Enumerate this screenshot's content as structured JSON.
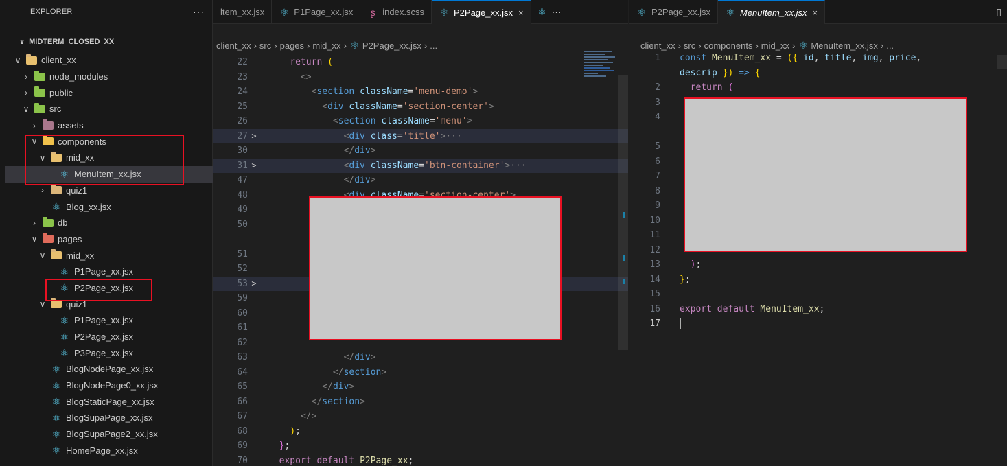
{
  "sidebar": {
    "title": "EXPLORER",
    "more": "···",
    "root": "MIDTERM_CLOSED_XX",
    "tree": [
      {
        "label": "client_xx",
        "depth": 1,
        "kind": "folder-open",
        "chev": "down"
      },
      {
        "label": "node_modules",
        "depth": 2,
        "kind": "folder-green",
        "chev": "right"
      },
      {
        "label": "public",
        "depth": 2,
        "kind": "folder-green",
        "chev": "right"
      },
      {
        "label": "src",
        "depth": 2,
        "kind": "folder-green",
        "chev": "down"
      },
      {
        "label": "assets",
        "depth": 3,
        "kind": "folder-pink",
        "chev": "right"
      },
      {
        "label": "components",
        "depth": 3,
        "kind": "folder-yellow",
        "chev": "down"
      },
      {
        "label": "mid_xx",
        "depth": 4,
        "kind": "folder-open",
        "chev": "down"
      },
      {
        "label": "MenuItem_xx.jsx",
        "depth": 5,
        "kind": "react",
        "chev": "none",
        "selected": true
      },
      {
        "label": "quiz1",
        "depth": 4,
        "kind": "folder",
        "chev": "right"
      },
      {
        "label": "Blog_xx.jsx",
        "depth": 4,
        "kind": "react",
        "chev": "none"
      },
      {
        "label": "db",
        "depth": 3,
        "kind": "folder-green",
        "chev": "right"
      },
      {
        "label": "pages",
        "depth": 3,
        "kind": "folder-red",
        "chev": "down"
      },
      {
        "label": "mid_xx",
        "depth": 4,
        "kind": "folder-open",
        "chev": "down"
      },
      {
        "label": "P1Page_xx.jsx",
        "depth": 5,
        "kind": "react",
        "chev": "none"
      },
      {
        "label": "P2Page_xx.jsx",
        "depth": 5,
        "kind": "react",
        "chev": "none"
      },
      {
        "label": "quiz1",
        "depth": 4,
        "kind": "folder-open",
        "chev": "down"
      },
      {
        "label": "P1Page_xx.jsx",
        "depth": 5,
        "kind": "react",
        "chev": "none"
      },
      {
        "label": "P2Page_xx.jsx",
        "depth": 5,
        "kind": "react",
        "chev": "none"
      },
      {
        "label": "P3Page_xx.jsx",
        "depth": 5,
        "kind": "react",
        "chev": "none"
      },
      {
        "label": "BlogNodePage_xx.jsx",
        "depth": 4,
        "kind": "react",
        "chev": "none"
      },
      {
        "label": "BlogNodePage0_xx.jsx",
        "depth": 4,
        "kind": "react",
        "chev": "none"
      },
      {
        "label": "BlogStaticPage_xx.jsx",
        "depth": 4,
        "kind": "react",
        "chev": "none"
      },
      {
        "label": "BlogSupaPage_xx.jsx",
        "depth": 4,
        "kind": "react",
        "chev": "none"
      },
      {
        "label": "BlogSupaPage2_xx.jsx",
        "depth": 4,
        "kind": "react",
        "chev": "none"
      },
      {
        "label": "HomePage_xx.jsx",
        "depth": 4,
        "kind": "react",
        "chev": "none"
      }
    ]
  },
  "editor1": {
    "tabs": [
      {
        "label": "ltem_xx.jsx",
        "icon": "none"
      },
      {
        "label": "P1Page_xx.jsx",
        "icon": "react"
      },
      {
        "label": "index.scss",
        "icon": "sass"
      },
      {
        "label": "P2Page_xx.jsx",
        "icon": "react",
        "active": true,
        "close": "×"
      }
    ],
    "tab_overflow": "···",
    "breadcrumb": [
      "client_xx",
      "src",
      "pages",
      "mid_xx",
      "P2Page_xx.jsx",
      "..."
    ],
    "lines": [
      {
        "n": "22",
        "code": [
          [
            "    ",
            "plain"
          ],
          [
            "return",
            "kw2"
          ],
          [
            " (",
            "br1"
          ]
        ]
      },
      {
        "n": "23",
        "code": [
          [
            "      ",
            "plain"
          ],
          [
            "<>",
            "pun"
          ]
        ]
      },
      {
        "n": "24",
        "code": [
          [
            "        ",
            "plain"
          ],
          [
            "<",
            "pun"
          ],
          [
            "section",
            "tag"
          ],
          [
            " ",
            "plain"
          ],
          [
            "className",
            "attr"
          ],
          [
            "=",
            "plain"
          ],
          [
            "'menu-demo'",
            "str"
          ],
          [
            ">",
            "pun"
          ]
        ]
      },
      {
        "n": "25",
        "code": [
          [
            "          ",
            "plain"
          ],
          [
            "<",
            "pun"
          ],
          [
            "div",
            "tag"
          ],
          [
            " ",
            "plain"
          ],
          [
            "className",
            "attr"
          ],
          [
            "=",
            "plain"
          ],
          [
            "'section-center'",
            "str"
          ],
          [
            ">",
            "pun"
          ]
        ]
      },
      {
        "n": "26",
        "code": [
          [
            "            ",
            "plain"
          ],
          [
            "<",
            "pun"
          ],
          [
            "section",
            "tag"
          ],
          [
            " ",
            "plain"
          ],
          [
            "className",
            "attr"
          ],
          [
            "=",
            "plain"
          ],
          [
            "'menu'",
            "str"
          ],
          [
            ">",
            "pun"
          ]
        ]
      },
      {
        "n": "27",
        "fold": ">",
        "folded": true,
        "code": [
          [
            "              ",
            "plain"
          ],
          [
            "<",
            "pun"
          ],
          [
            "div",
            "tag"
          ],
          [
            " ",
            "plain"
          ],
          [
            "class",
            "attr"
          ],
          [
            "=",
            "plain"
          ],
          [
            "'title'",
            "str"
          ],
          [
            ">",
            "pun"
          ],
          [
            "···",
            "ell"
          ]
        ]
      },
      {
        "n": "30",
        "code": [
          [
            "              ",
            "plain"
          ],
          [
            "</",
            "pun"
          ],
          [
            "div",
            "tag"
          ],
          [
            ">",
            "pun"
          ]
        ]
      },
      {
        "n": "31",
        "fold": ">",
        "folded": true,
        "code": [
          [
            "              ",
            "plain"
          ],
          [
            "<",
            "pun"
          ],
          [
            "div",
            "tag"
          ],
          [
            " ",
            "plain"
          ],
          [
            "className",
            "attr"
          ],
          [
            "=",
            "plain"
          ],
          [
            "'btn-container'",
            "str"
          ],
          [
            ">",
            "pun"
          ],
          [
            "···",
            "ell"
          ]
        ]
      },
      {
        "n": "47",
        "code": [
          [
            "              ",
            "plain"
          ],
          [
            "</",
            "pun"
          ],
          [
            "div",
            "tag"
          ],
          [
            ">",
            "pun"
          ]
        ]
      },
      {
        "n": "48",
        "code": [
          [
            "              ",
            "plain"
          ],
          [
            "<",
            "pun"
          ],
          [
            "div",
            "tag"
          ],
          [
            " ",
            "plain"
          ],
          [
            "className",
            "attr"
          ],
          [
            "=",
            "plain"
          ],
          [
            "'section-center'",
            "str"
          ],
          [
            ">",
            "pun"
          ]
        ]
      },
      {
        "n": "49",
        "code": []
      },
      {
        "n": "50",
        "code": []
      },
      {
        "n": "",
        "code": []
      },
      {
        "n": "51",
        "code": []
      },
      {
        "n": "52",
        "code": []
      },
      {
        "n": "53",
        "fold": ">",
        "folded": true,
        "code": []
      },
      {
        "n": "59",
        "code": []
      },
      {
        "n": "60",
        "code": []
      },
      {
        "n": "61",
        "code": []
      },
      {
        "n": "62",
        "code": []
      },
      {
        "n": "63",
        "code": [
          [
            "              ",
            "plain"
          ],
          [
            "</",
            "pun"
          ],
          [
            "div",
            "tag"
          ],
          [
            ">",
            "pun"
          ]
        ]
      },
      {
        "n": "64",
        "code": [
          [
            "            ",
            "plain"
          ],
          [
            "</",
            "pun"
          ],
          [
            "section",
            "tag"
          ],
          [
            ">",
            "pun"
          ]
        ]
      },
      {
        "n": "65",
        "code": [
          [
            "          ",
            "plain"
          ],
          [
            "</",
            "pun"
          ],
          [
            "div",
            "tag"
          ],
          [
            ">",
            "pun"
          ]
        ]
      },
      {
        "n": "66",
        "code": [
          [
            "        ",
            "plain"
          ],
          [
            "</",
            "pun"
          ],
          [
            "section",
            "tag"
          ],
          [
            ">",
            "pun"
          ]
        ]
      },
      {
        "n": "67",
        "code": [
          [
            "      ",
            "plain"
          ],
          [
            "</>",
            "pun"
          ]
        ]
      },
      {
        "n": "68",
        "code": [
          [
            "    ",
            "plain"
          ],
          [
            ")",
            "br1"
          ],
          [
            ";",
            "plain"
          ]
        ]
      },
      {
        "n": "69",
        "code": [
          [
            "  ",
            "plain"
          ],
          [
            "}",
            "br2"
          ],
          [
            ";",
            "plain"
          ]
        ]
      },
      {
        "n": "70",
        "code": [
          [
            "  ",
            "plain"
          ],
          [
            "export",
            "kw2"
          ],
          [
            " ",
            "plain"
          ],
          [
            "default",
            "kw2"
          ],
          [
            " ",
            "plain"
          ],
          [
            "P2Page_xx",
            "fn"
          ],
          [
            ";",
            "plain"
          ]
        ]
      },
      {
        "n": "71",
        "cur": true,
        "code": []
      }
    ]
  },
  "editor2": {
    "tabs": [
      {
        "label": "P2Page_xx.jsx",
        "icon": "react"
      },
      {
        "label": "MenuItem_xx.jsx",
        "icon": "react",
        "active": true,
        "italic": true,
        "close": "×"
      }
    ],
    "tab_action": "▯",
    "breadcrumb": [
      "client_xx",
      "src",
      "components",
      "mid_xx",
      "MenuItem_xx.jsx",
      "..."
    ],
    "lines": [
      {
        "n": "1",
        "code": [
          [
            "const",
            "kw"
          ],
          [
            " ",
            "plain"
          ],
          [
            "MenuItem_xx",
            "fn"
          ],
          [
            " = ",
            "plain"
          ],
          [
            "({",
            "br1"
          ],
          [
            " ",
            "plain"
          ],
          [
            "id",
            "attr"
          ],
          [
            ", ",
            "plain"
          ],
          [
            "title",
            "attr"
          ],
          [
            ", ",
            "plain"
          ],
          [
            "img",
            "attr"
          ],
          [
            ", ",
            "plain"
          ],
          [
            "price",
            "attr"
          ],
          [
            ",",
            "plain"
          ]
        ]
      },
      {
        "n": "",
        "code": [
          [
            "descrip",
            "attr"
          ],
          [
            " ",
            "plain"
          ],
          [
            "})",
            "br1"
          ],
          [
            " => ",
            "kw"
          ],
          [
            "{",
            "br1"
          ]
        ]
      },
      {
        "n": "2",
        "code": [
          [
            "  ",
            "plain"
          ],
          [
            "return",
            "kw2"
          ],
          [
            " (",
            "br2"
          ]
        ]
      },
      {
        "n": "3",
        "code": []
      },
      {
        "n": "4",
        "code": []
      },
      {
        "n": "",
        "code": []
      },
      {
        "n": "5",
        "code": []
      },
      {
        "n": "6",
        "code": []
      },
      {
        "n": "7",
        "code": []
      },
      {
        "n": "8",
        "code": []
      },
      {
        "n": "9",
        "code": []
      },
      {
        "n": "10",
        "code": []
      },
      {
        "n": "11",
        "code": []
      },
      {
        "n": "12",
        "code": []
      },
      {
        "n": "13",
        "code": [
          [
            "  ",
            "plain"
          ],
          [
            ")",
            "br2"
          ],
          [
            ";",
            "plain"
          ]
        ]
      },
      {
        "n": "14",
        "code": [
          [
            "}",
            "br1"
          ],
          [
            ";",
            "plain"
          ]
        ]
      },
      {
        "n": "15",
        "code": []
      },
      {
        "n": "16",
        "code": [
          [
            "export",
            "kw2"
          ],
          [
            " ",
            "plain"
          ],
          [
            "default",
            "kw2"
          ],
          [
            " ",
            "plain"
          ],
          [
            "MenuItem_xx",
            "fn"
          ],
          [
            ";",
            "plain"
          ]
        ]
      },
      {
        "n": "17",
        "cur": true,
        "cursor": true,
        "code": []
      }
    ]
  },
  "colors": {
    "highlight_box": "#e81123",
    "mask": "#c8c8c8",
    "accent": "#0078d4",
    "react_icon": "#61dafb"
  }
}
